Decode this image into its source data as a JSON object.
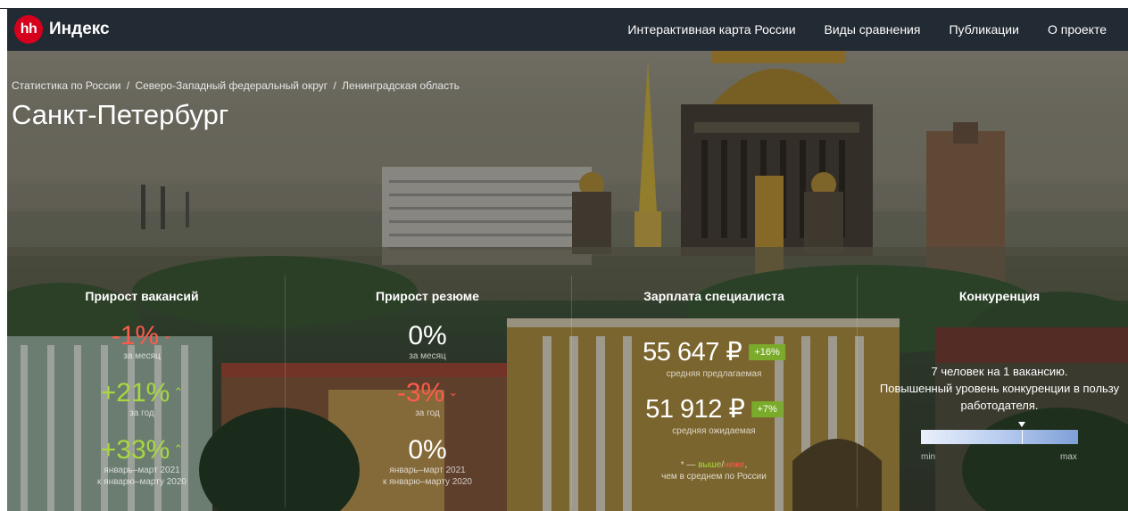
{
  "header": {
    "logo_badge": "hh",
    "logo_text": "Индекс",
    "nav": [
      {
        "label": "Интерактивная карта России"
      },
      {
        "label": "Виды сравнения"
      },
      {
        "label": "Публикации"
      },
      {
        "label": "О проекте"
      }
    ]
  },
  "hero": {
    "breadcrumb": [
      "Статистика по России",
      "Северо-Западный федеральный округ",
      "Ленинградская область"
    ],
    "breadcrumb_separator": "/",
    "title": "Санкт-Петербург"
  },
  "stats": {
    "vacancies": {
      "heading": "Прирост вакансий",
      "items": [
        {
          "value": "-1%",
          "trend": "down",
          "arrow": "⌄",
          "label": "за месяц"
        },
        {
          "value": "+21%",
          "trend": "up",
          "arrow": "⌃",
          "label": "за год"
        },
        {
          "value": "+33%",
          "trend": "up",
          "arrow": "⌃",
          "label": "январь–март 2021",
          "label2": "к январю–марту 2020"
        }
      ]
    },
    "resumes": {
      "heading": "Прирост резюме",
      "items": [
        {
          "value": "0%",
          "trend": "none",
          "label": "за месяц"
        },
        {
          "value": "-3%",
          "trend": "down",
          "arrow": "⌄",
          "label": "за год"
        },
        {
          "value": "0%",
          "trend": "none",
          "label": "январь–март 2021",
          "label2": "к январю–марту 2020"
        }
      ]
    },
    "salary": {
      "heading": "Зарплата специалиста",
      "offered": {
        "amount": "55 647 ₽",
        "badge": "+16%",
        "label": "средняя предлагаемая"
      },
      "expected": {
        "amount": "51 912 ₽",
        "badge": "+7%",
        "label": "средняя ожидаемая"
      },
      "footnote": {
        "mark": "* — ",
        "above": "выше",
        "slash": "/",
        "below": "ниже",
        "comma": ",",
        "line2": "чем в среднем по России"
      }
    },
    "competition": {
      "heading": "Конкуренция",
      "line1": "7 человек на 1 вакансию.",
      "line2": "Повышенный уровень конкуренции в пользу",
      "line3": "работодателя.",
      "scale_min": "min",
      "scale_max": "max",
      "level": 0.64
    }
  },
  "colors": {
    "header_bg": "#222a33",
    "brand_red": "#d6001c",
    "negative": "#ff5a4b",
    "positive": "#a8d840",
    "badge_green": "#7aab2a"
  }
}
